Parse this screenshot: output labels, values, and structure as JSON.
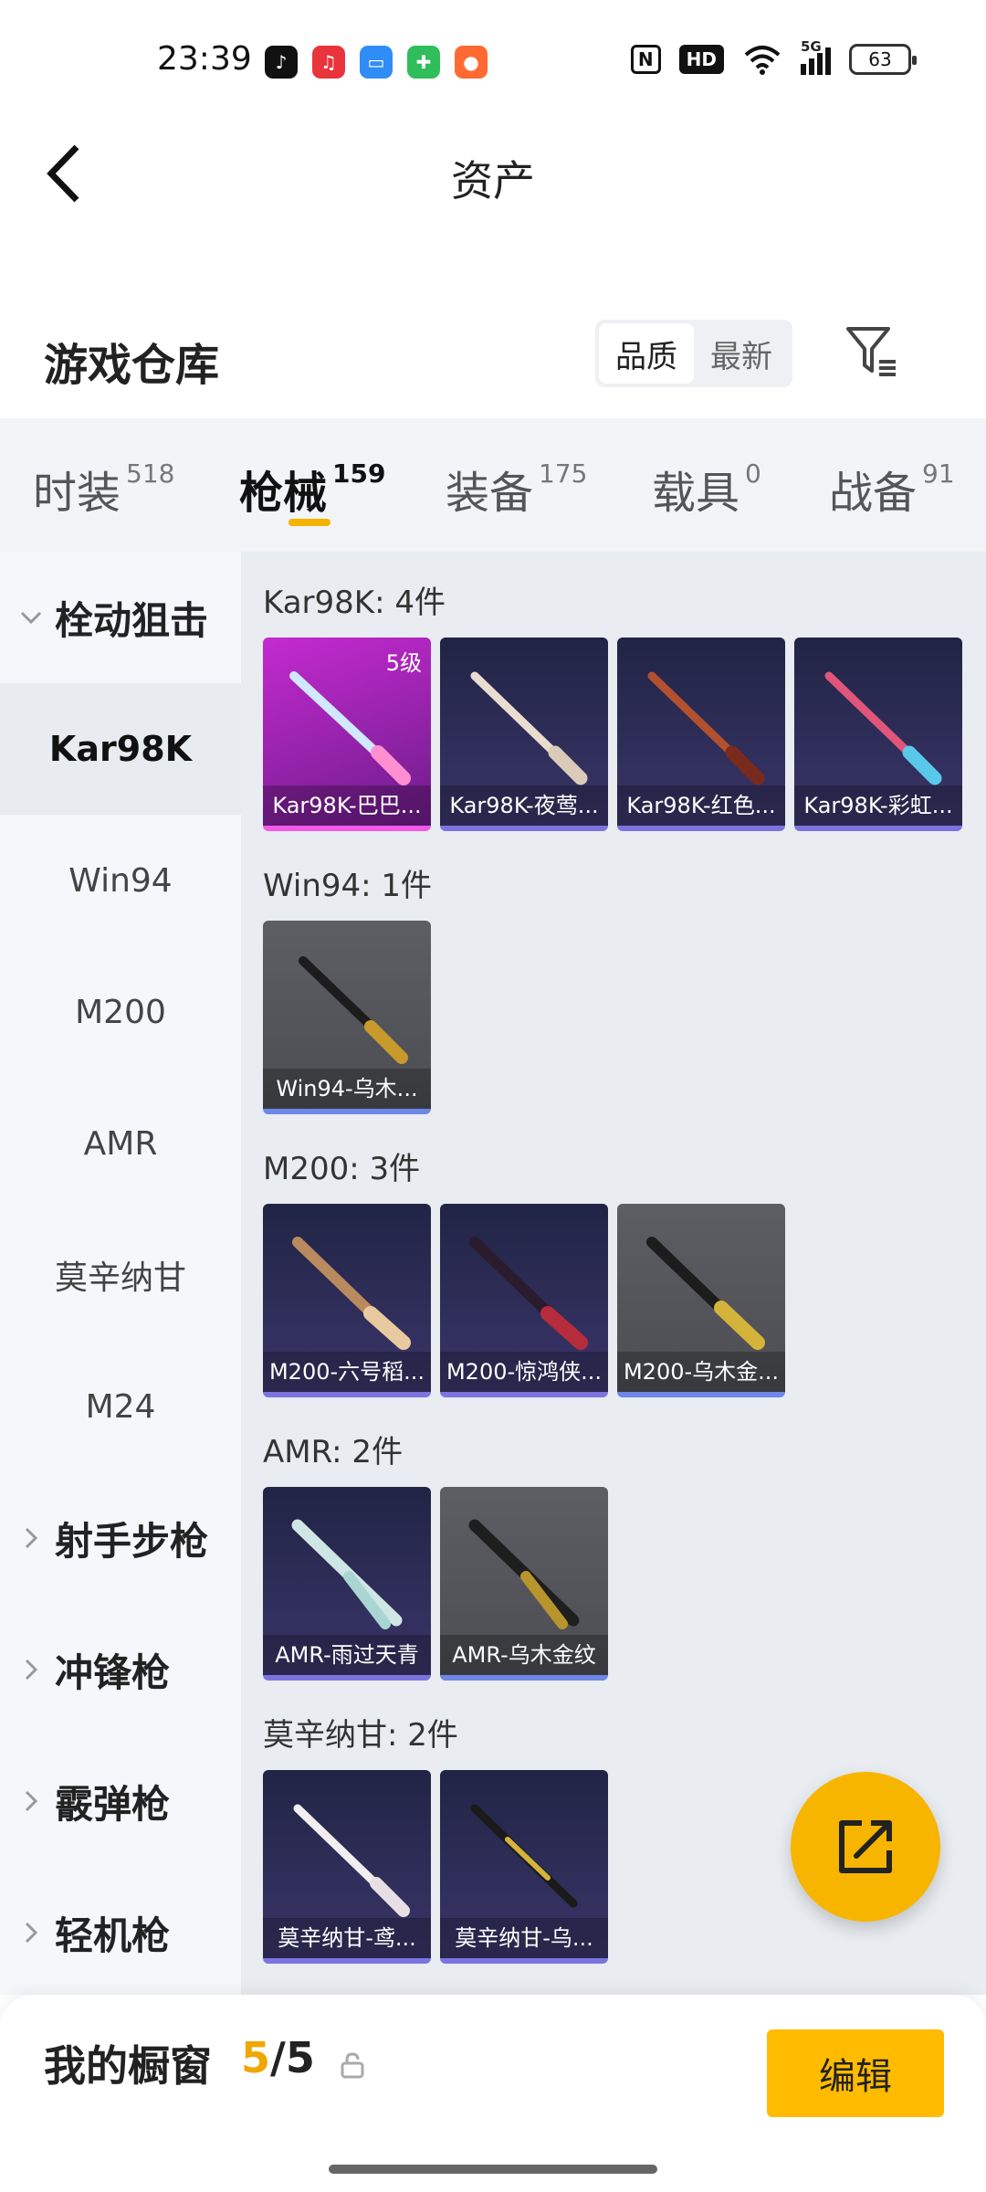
{
  "status_bar": {
    "time": "23:39",
    "nfc": "N",
    "hd": "HD",
    "network": "5G",
    "battery": "63"
  },
  "header": {
    "title": "资产"
  },
  "warehouse": {
    "title": "游戏仓库",
    "sort_options": [
      "品质",
      "最新"
    ],
    "active_sort": "品质"
  },
  "tabs": [
    {
      "label": "时装",
      "count": "518"
    },
    {
      "label": "枪械",
      "count": "159"
    },
    {
      "label": "装备",
      "count": "175"
    },
    {
      "label": "载具",
      "count": "0"
    },
    {
      "label": "战备",
      "count": "91"
    }
  ],
  "active_tab": "枪械",
  "sidebar": {
    "expanded_group": "栓动狙击",
    "sub_items": [
      "Kar98K",
      "Win94",
      "M200",
      "AMR",
      "莫辛纳甘",
      "M24"
    ],
    "active_sub": "Kar98K",
    "collapsed_groups": [
      "射手步枪",
      "冲锋枪",
      "霰弹枪",
      "轻机枪"
    ]
  },
  "groups": [
    {
      "title": "Kar98K: 4件",
      "items": [
        {
          "label": "Kar98K-巴巴...",
          "level": "5级",
          "style": "pink"
        },
        {
          "label": "Kar98K-夜莺...",
          "style": "purple"
        },
        {
          "label": "Kar98K-红色...",
          "style": "purple"
        },
        {
          "label": "Kar98K-彩虹...",
          "style": "purple"
        }
      ]
    },
    {
      "title": "Win94: 1件",
      "items": [
        {
          "label": "Win94-乌木...",
          "style": "gray"
        }
      ]
    },
    {
      "title": "M200: 3件",
      "items": [
        {
          "label": "M200-六号稻...",
          "style": "purple"
        },
        {
          "label": "M200-惊鸿侠...",
          "style": "purple"
        },
        {
          "label": "M200-乌木金...",
          "style": "gray"
        }
      ]
    },
    {
      "title": "AMR: 2件",
      "items": [
        {
          "label": "AMR-雨过天青",
          "style": "purple"
        },
        {
          "label": "AMR-乌木金纹",
          "style": "gray"
        }
      ]
    },
    {
      "title": "莫辛纳甘: 2件",
      "items": [
        {
          "label": "莫辛纳甘-鸢...",
          "style": "purple"
        },
        {
          "label": "莫辛纳甘-乌...",
          "style": "purple"
        }
      ]
    }
  ],
  "showcase": {
    "title": "我的橱窗",
    "current": "5",
    "separator": "/",
    "total": "5",
    "edit_label": "编辑"
  },
  "colors": {
    "accent": "#ffbb00",
    "tab_indicator": "#f5b300",
    "count_highlight": "#f0a600"
  }
}
